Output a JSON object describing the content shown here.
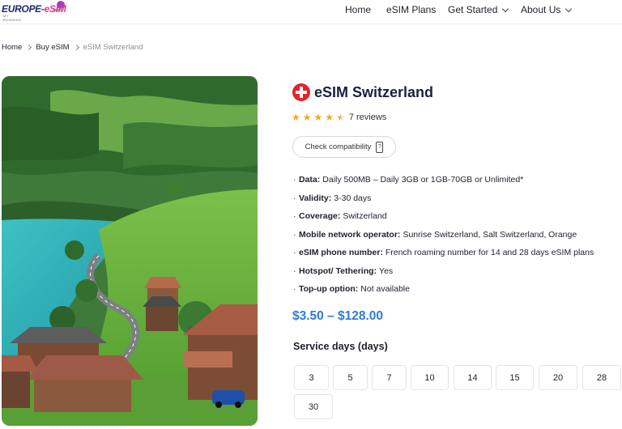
{
  "header": {
    "logo_main": "EUROPE-",
    "logo_accent": "eSIM",
    "logo_tld": ".com",
    "logo_sub": "MY ROAMING",
    "nav": {
      "home": "Home",
      "plans": "eSIM Plans",
      "started": "Get Started",
      "about": "About Us"
    }
  },
  "breadcrumb": {
    "home": "Home",
    "buy": "Buy eSIM",
    "current": "eSIM Switzerland"
  },
  "product": {
    "title": "eSIM Switzerland",
    "rating_stars": 4.5,
    "reviews": "7 reviews",
    "check_label": "Check compatibility",
    "features": [
      {
        "key": "Data:",
        "value": "Daily 500MB – Daily 3GB or 1GB-70GB or Unlimited*"
      },
      {
        "key": "Validity:",
        "value": "3-30 days"
      },
      {
        "key": "Coverage:",
        "value": "Switzerland"
      },
      {
        "key": "Mobile network operator:",
        "value": "Sunrise Switzerland, Salt Switzerland, Orange"
      },
      {
        "key": "eSIM phone number:",
        "value": "French roaming number for 14 and 28 days eSIM plans"
      },
      {
        "key": "Hotspot/ Tethering:",
        "value": "Yes"
      },
      {
        "key": "Top-up option:",
        "value": "Not available"
      }
    ],
    "price": "$3.50 – $128.00",
    "service_label": "Service days (days)",
    "days": [
      "3",
      "5",
      "7",
      "10",
      "14",
      "15",
      "20",
      "28",
      "30"
    ]
  },
  "colors": {
    "brand_navy": "#1c2a6b",
    "brand_pink": "#e23c8c",
    "price_blue": "#2e7cd6",
    "star": "#f5a623",
    "flag_red": "#e3242b"
  }
}
